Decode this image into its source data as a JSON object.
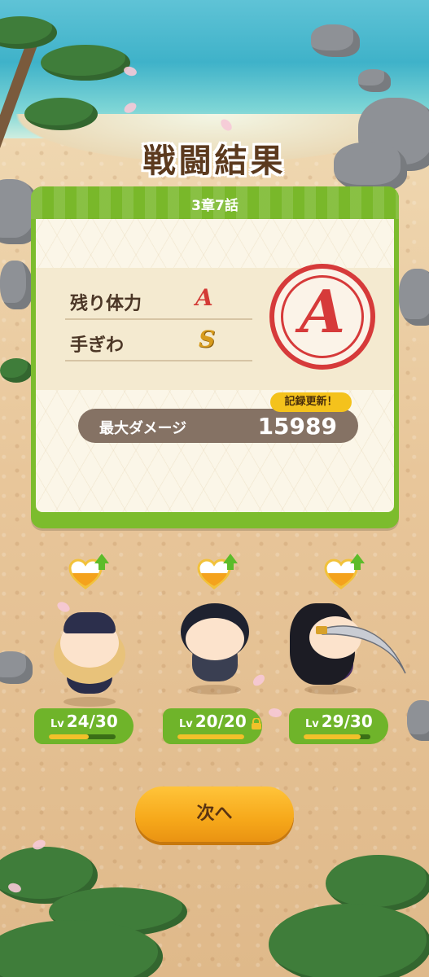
{
  "screen": {
    "title": "戦闘結果",
    "chapter": "3章7話"
  },
  "grades": {
    "rows": [
      {
        "label": "残り体力",
        "grade": "A"
      },
      {
        "label": "手ぎわ",
        "grade": "S"
      }
    ],
    "overall": "A"
  },
  "damage": {
    "label": "最大ダメージ",
    "value": "15989",
    "record_badge": "記録更新！"
  },
  "party": [
    {
      "lv": "24/30",
      "progress": 0.6,
      "locked": false
    },
    {
      "lv": "20/20",
      "progress": 1.0,
      "locked": true
    },
    {
      "lv": "29/30",
      "progress": 0.85,
      "locked": false
    }
  ],
  "lv_prefix": "Lv",
  "next_button": "次へ",
  "colors": {
    "panel_green": "#7cbc2d",
    "grade_red": "#d33b36",
    "grade_gold": "#d79b1c",
    "button_orange": "#f6a81a"
  }
}
